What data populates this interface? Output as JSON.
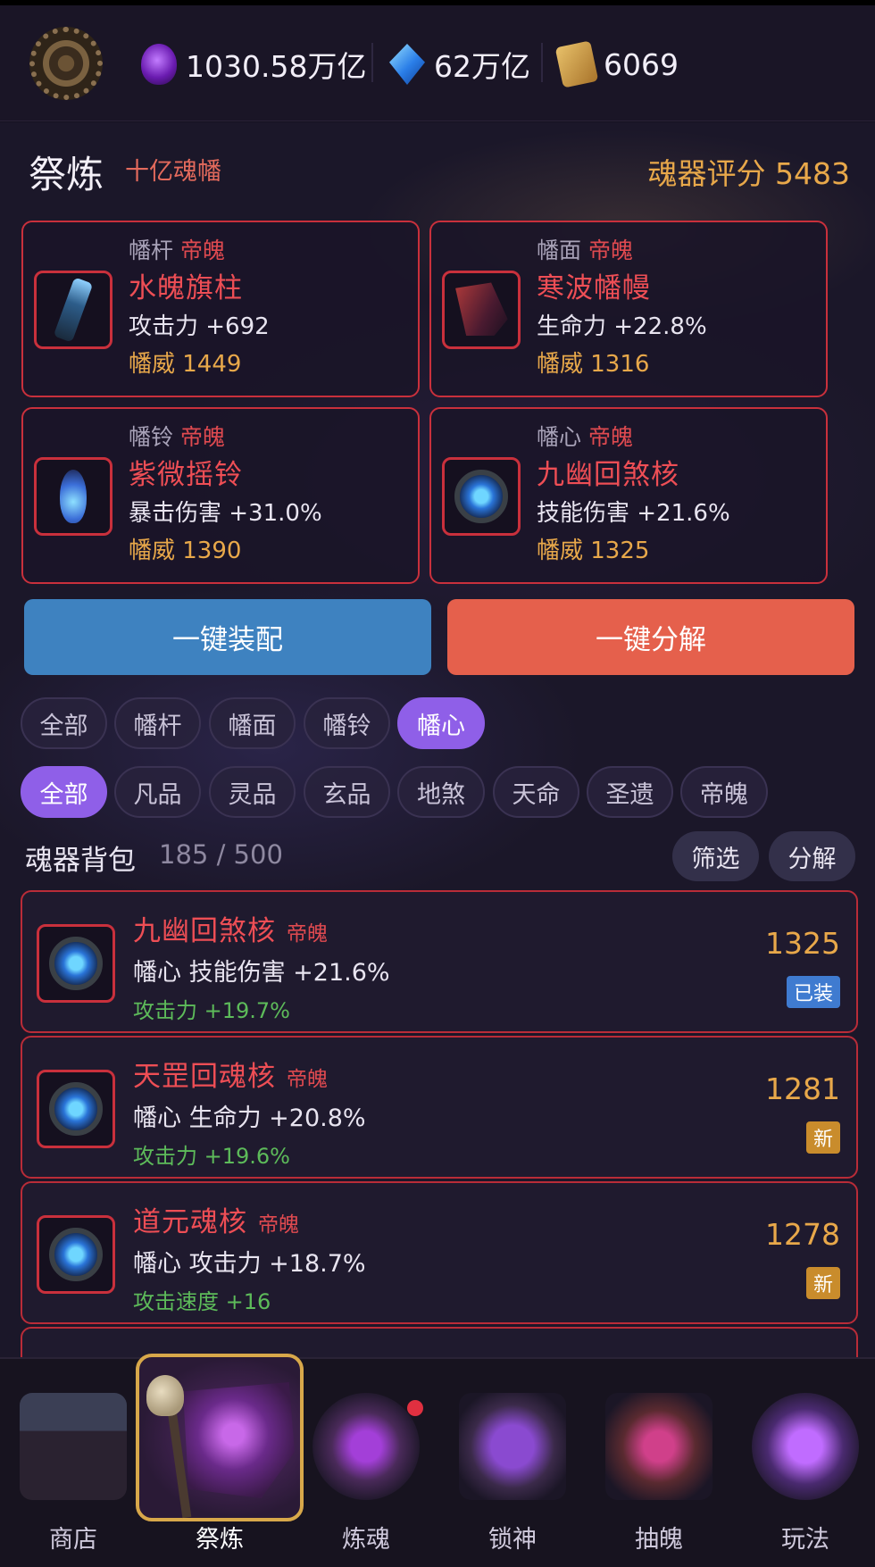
{
  "topbar": {
    "settings_icon": "gear-icon",
    "resources": [
      {
        "icon": "soul-orb-icon",
        "value": "1030.58万亿"
      },
      {
        "icon": "crystal-icon",
        "value": "62万亿"
      },
      {
        "icon": "scroll-icon",
        "value": "6069"
      }
    ]
  },
  "header": {
    "title": "祭炼",
    "subtitle": "十亿魂幡",
    "score_label": "魂器评分 5483"
  },
  "slots": [
    {
      "type": "幡杆",
      "rarity": "帝魄",
      "name": "水魄旗柱",
      "stat": "攻击力 +692",
      "power": "幡威 1449"
    },
    {
      "type": "幡面",
      "rarity": "帝魄",
      "name": "寒波幡幔",
      "stat": "生命力 +22.8%",
      "power": "幡威 1316"
    },
    {
      "type": "幡铃",
      "rarity": "帝魄",
      "name": "紫微摇铃",
      "stat": "暴击伤害 +31.0%",
      "power": "幡威 1390"
    },
    {
      "type": "幡心",
      "rarity": "帝魄",
      "name": "九幽回煞核",
      "stat": "技能伤害 +21.6%",
      "power": "幡威 1325"
    }
  ],
  "actions": {
    "equip_all": "一键装配",
    "decompose_all": "一键分解"
  },
  "part_filters": [
    "全部",
    "幡杆",
    "幡面",
    "幡铃",
    "幡心"
  ],
  "part_filter_active": "幡心",
  "rarity_filters": [
    "全部",
    "凡品",
    "灵品",
    "玄品",
    "地煞",
    "天命",
    "圣遗",
    "帝魄"
  ],
  "rarity_filter_active": "全部",
  "bag": {
    "title": "魂器背包",
    "count": "185 / 500",
    "filter_button": "筛选",
    "decompose_button": "分解"
  },
  "items": [
    {
      "name": "九幽回煞核",
      "rarity": "帝魄",
      "stat": "幡心  技能伤害 +21.6%",
      "sub": "攻击力 +19.7%",
      "power": "1325",
      "badge": "已装"
    },
    {
      "name": "天罡回魂核",
      "rarity": "帝魄",
      "stat": "幡心  生命力 +20.8%",
      "sub": "攻击力 +19.6%",
      "power": "1281",
      "badge": "新"
    },
    {
      "name": "道元魂核",
      "rarity": "帝魄",
      "stat": "幡心  攻击力 +18.7%",
      "sub": "攻击速度 +16",
      "power": "1278",
      "badge": "新"
    }
  ],
  "nav": [
    {
      "label": "商店",
      "icon": "shop-icon"
    },
    {
      "label": "祭炼",
      "icon": "banner-icon"
    },
    {
      "label": "炼魂",
      "icon": "skull-orb-icon"
    },
    {
      "label": "锁神",
      "icon": "chain-icon"
    },
    {
      "label": "抽魄",
      "icon": "portal-icon"
    },
    {
      "label": "玩法",
      "icon": "spirit-icon"
    }
  ],
  "colors": {
    "accent_purple": "#8f5fe8",
    "equip_blue": "#3e82c0",
    "decompose_red": "#e5604c",
    "rarity_red": "#ee4e55",
    "gold": "#e8a84a",
    "positive_green": "#5dbb5a"
  }
}
